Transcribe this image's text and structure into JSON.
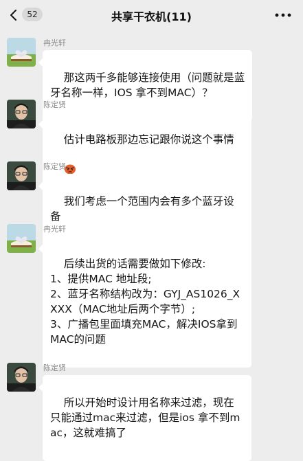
{
  "header": {
    "badge": "52",
    "title": "共享干衣机(11)",
    "back_icon": "chevron-left-icon",
    "more_icon": "more-dots-icon"
  },
  "messages": [
    {
      "sender": "冉光轩",
      "text": "那这两千多能够连接使用（问题就是蓝牙名称一样，IOS 拿不到MAC）？"
    },
    {
      "sender": "陈定贤",
      "text": "估计电路板那边忘记跟你说这个事情",
      "emoji": "angry-face-emoji"
    },
    {
      "sender": "陈定贤",
      "text": "我们考虑一个范围内会有多个蓝牙设备"
    },
    {
      "sender": "冉光轩",
      "text": "后续出货的话需要做如下修改:\n1、提供MAC 地址段;\n2、蓝牙名称结构改为：GYJ_AS1026_XXXX（MAC地址后两个字节）;\n3、广播包里面填充MAC，解决IOS拿到MAC的问题"
    },
    {
      "sender": "陈定贤",
      "text": "所以开始时设计用名称来过滤，现在只能通过mac来过滤，但是ios 拿不到mac，这就难搞了"
    }
  ]
}
